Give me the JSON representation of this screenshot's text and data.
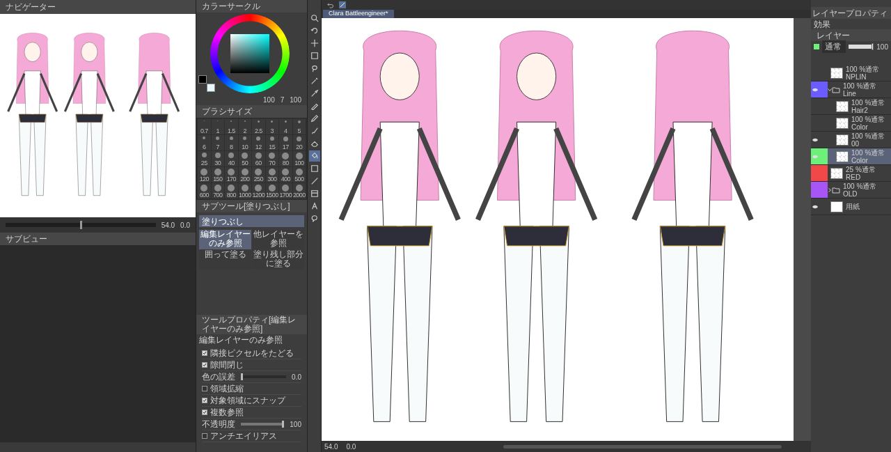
{
  "navigator": {
    "title": "ナビゲーター",
    "zoom": "54.0",
    "angle": "0.0",
    "level": 0.5
  },
  "subview": {
    "title": "サブビュー"
  },
  "color_circle": {
    "title": "カラーサークル",
    "readings": [
      "100",
      "7",
      "100"
    ]
  },
  "brush_size": {
    "title": "ブラシサイズ",
    "sizes": [
      "0.7",
      "1",
      "1.5",
      "2",
      "2.5",
      "3",
      "4",
      "5",
      "6",
      "7",
      "8",
      "10",
      "12",
      "15",
      "17",
      "20",
      "25",
      "30",
      "40",
      "50",
      "60",
      "70",
      "80",
      "100",
      "120",
      "150",
      "170",
      "200",
      "250",
      "300",
      "400",
      "500",
      "600",
      "700",
      "800",
      "1000",
      "1200",
      "1500",
      "1700",
      "2000"
    ]
  },
  "sub_tool": {
    "title": "サブツール[塗りつぶし]",
    "group": "塗りつぶし",
    "items": [
      {
        "label": "編集レイヤーのみ参照",
        "selected": true
      },
      {
        "label": "他レイヤーを参照",
        "selected": false
      },
      {
        "label": "囲って塗る",
        "selected": false
      },
      {
        "label": "塗り残し部分に塗る",
        "selected": false
      }
    ]
  },
  "tool_property": {
    "title": "ツールプロパティ[編集レイヤーのみ参照]",
    "heading": "編集レイヤーのみ参照",
    "rows": [
      {
        "kind": "check",
        "label": "隣接ピクセルをたどる",
        "checked": true
      },
      {
        "kind": "check",
        "label": "隙間閉じ",
        "checked": true
      },
      {
        "kind": "value",
        "label": "色の誤差",
        "value": "0.0",
        "level": 0
      },
      {
        "kind": "check",
        "label": "領域拡縮",
        "checked": false
      },
      {
        "kind": "check",
        "label": "対象領域にスナップ",
        "checked": true
      },
      {
        "kind": "check",
        "label": "複数参照",
        "checked": true
      },
      {
        "kind": "value",
        "label": "不透明度",
        "value": "100",
        "level": 1
      },
      {
        "kind": "check",
        "label": "アンチエイリアス",
        "checked": false
      }
    ]
  },
  "tools": [
    {
      "kind": "zoom",
      "selected": false
    },
    {
      "kind": "rotate",
      "selected": false
    },
    {
      "kind": "move",
      "selected": false
    },
    {
      "kind": "select",
      "selected": false
    },
    {
      "kind": "lasso",
      "selected": false
    },
    {
      "kind": "wand",
      "selected": false
    },
    {
      "kind": "eyedropper",
      "selected": false
    },
    {
      "kind": "pen",
      "selected": false
    },
    {
      "kind": "pencil",
      "selected": false
    },
    {
      "kind": "brush",
      "selected": false
    },
    {
      "kind": "eraser",
      "selected": false
    },
    {
      "kind": "fill",
      "selected": true
    },
    {
      "kind": "gradient",
      "selected": false
    },
    {
      "kind": "line",
      "selected": false
    },
    {
      "kind": "frame",
      "selected": false
    },
    {
      "kind": "text",
      "selected": false
    },
    {
      "kind": "balloon",
      "selected": false
    }
  ],
  "document_tab": {
    "title": "Clara Battleengineer*"
  },
  "canvas_status": {
    "zoom": "54.0",
    "angle": "0.0"
  },
  "layer_property": {
    "title": "レイヤープロパティ",
    "effect": "効果"
  },
  "layer_panel": {
    "title": "レイヤー",
    "blend_mode": "通常",
    "opacity": "100",
    "level": 1,
    "layers": [
      {
        "kind": "layer",
        "mode": "100 %通常",
        "name": "NPLIN",
        "visible": false,
        "selected": false
      },
      {
        "kind": "folder",
        "mode": "100 %通常",
        "name": "Line",
        "visible": true,
        "selected": false,
        "color": "#6a5cff",
        "expanded": true,
        "children": [
          {
            "kind": "layer",
            "mode": "100 %通常",
            "name": "Hair2",
            "visible": false,
            "selected": false
          },
          {
            "kind": "layer",
            "mode": "100 %通常",
            "name": "Color",
            "visible": false,
            "selected": false
          },
          {
            "kind": "layer",
            "mode": "100 %通常",
            "name": "00",
            "visible": true,
            "selected": false
          },
          {
            "kind": "layer",
            "mode": "100 %通常",
            "name": "Color",
            "visible": true,
            "selected": true,
            "color": "#6cf07a"
          }
        ]
      },
      {
        "kind": "layer",
        "mode": "25 %通常",
        "name": "RED",
        "visible": false,
        "selected": false,
        "color": "#f04848"
      },
      {
        "kind": "folder",
        "mode": "100 %通常",
        "name": "OLD",
        "visible": false,
        "selected": false,
        "color": "#a855f7",
        "expanded": false
      },
      {
        "kind": "paper",
        "name": "用紙",
        "visible": true,
        "selected": false
      }
    ]
  }
}
